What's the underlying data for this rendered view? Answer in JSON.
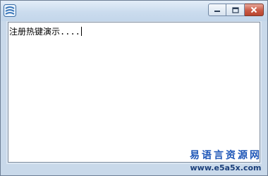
{
  "window": {
    "title": "",
    "icon": "app-logo-icon",
    "controls": [
      "minimize-icon",
      "maximize-icon",
      "close-icon"
    ],
    "accent": "#c95a45"
  },
  "editor": {
    "text": "注册热键演示...."
  },
  "watermark": {
    "title": "易语言资源网",
    "url": "www.e5a5x.com"
  }
}
